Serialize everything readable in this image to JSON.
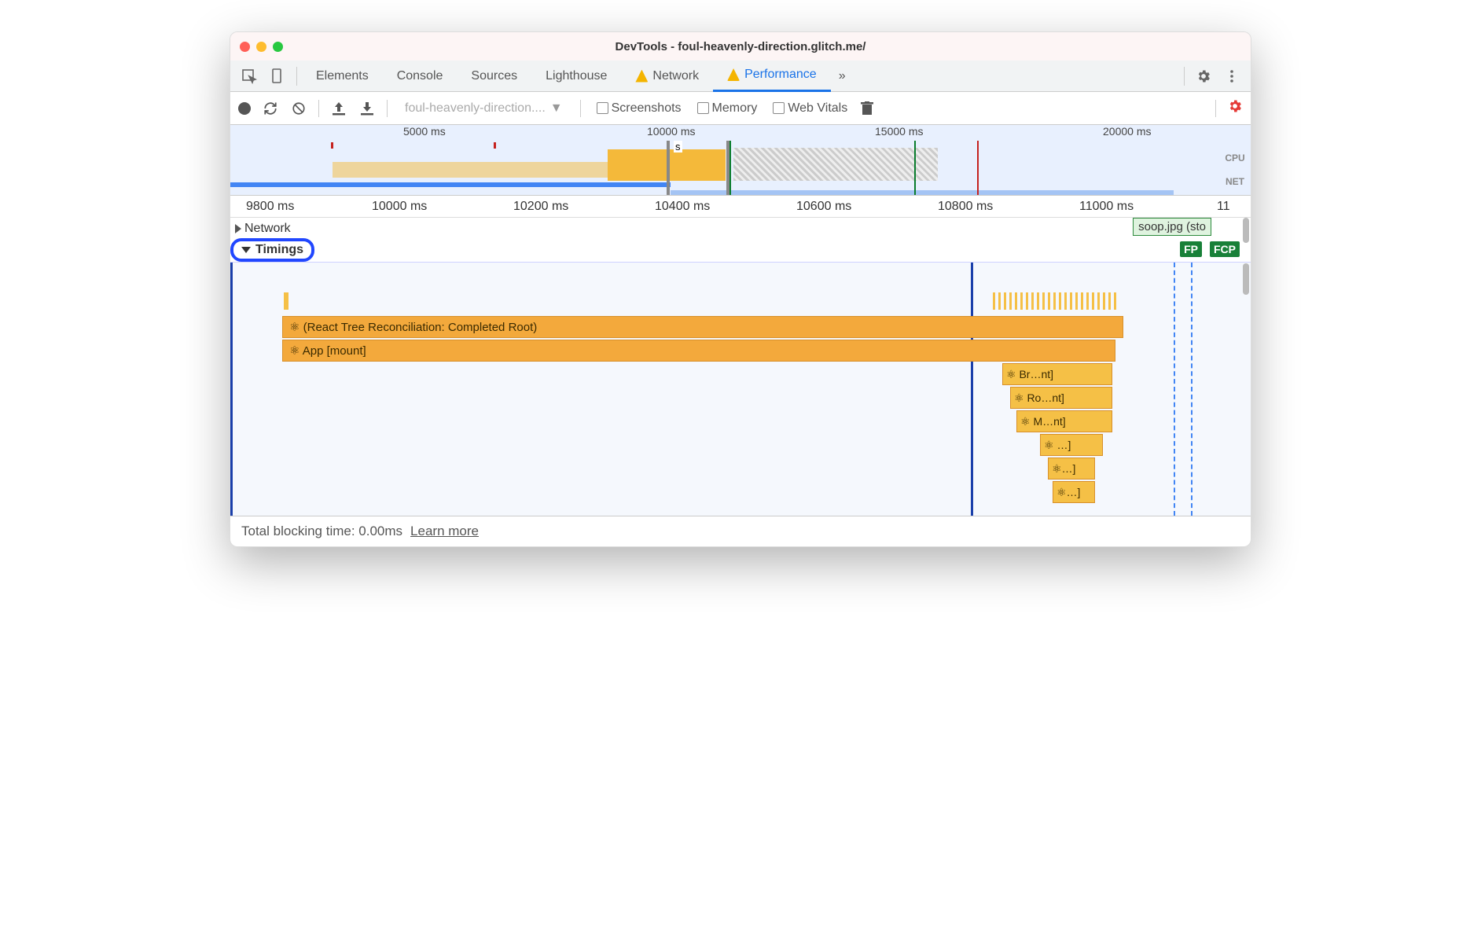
{
  "window": {
    "title": "DevTools - foul-heavenly-direction.glitch.me/"
  },
  "tabs": {
    "items": [
      "Elements",
      "Console",
      "Sources",
      "Lighthouse",
      "Network",
      "Performance"
    ],
    "active": "Performance",
    "more": "»"
  },
  "toolbar": {
    "dropdown": "foul-heavenly-direction....",
    "screenshots": "Screenshots",
    "memory": "Memory",
    "webvitals": "Web Vitals"
  },
  "overview": {
    "ticks": [
      "5000 ms",
      "10000 ms",
      "15000 ms",
      "20000 ms"
    ],
    "s_label": "s",
    "cpu": "CPU",
    "net": "NET"
  },
  "ruler": [
    "9800 ms",
    "10000 ms",
    "10200 ms",
    "10400 ms",
    "10600 ms",
    "10800 ms",
    "11000 ms",
    "11"
  ],
  "sections": {
    "network": "Network",
    "timings": "Timings"
  },
  "network_items": {
    "soop": "soop.jpg (sto"
  },
  "marks": {
    "fp": "FP",
    "fcp": "FCP"
  },
  "flames": {
    "root": "⚛ (React Tree Reconciliation: Completed Root)",
    "app": "⚛ App [mount]",
    "br": "⚛ Br…nt]",
    "ro": "⚛ Ro…nt]",
    "m": "⚛ M…nt]",
    "l1": "⚛ …]",
    "l2": "⚛…]",
    "l3": "⚛…]"
  },
  "footer": {
    "tbt": "Total blocking time: 0.00ms",
    "learn": "Learn more"
  }
}
